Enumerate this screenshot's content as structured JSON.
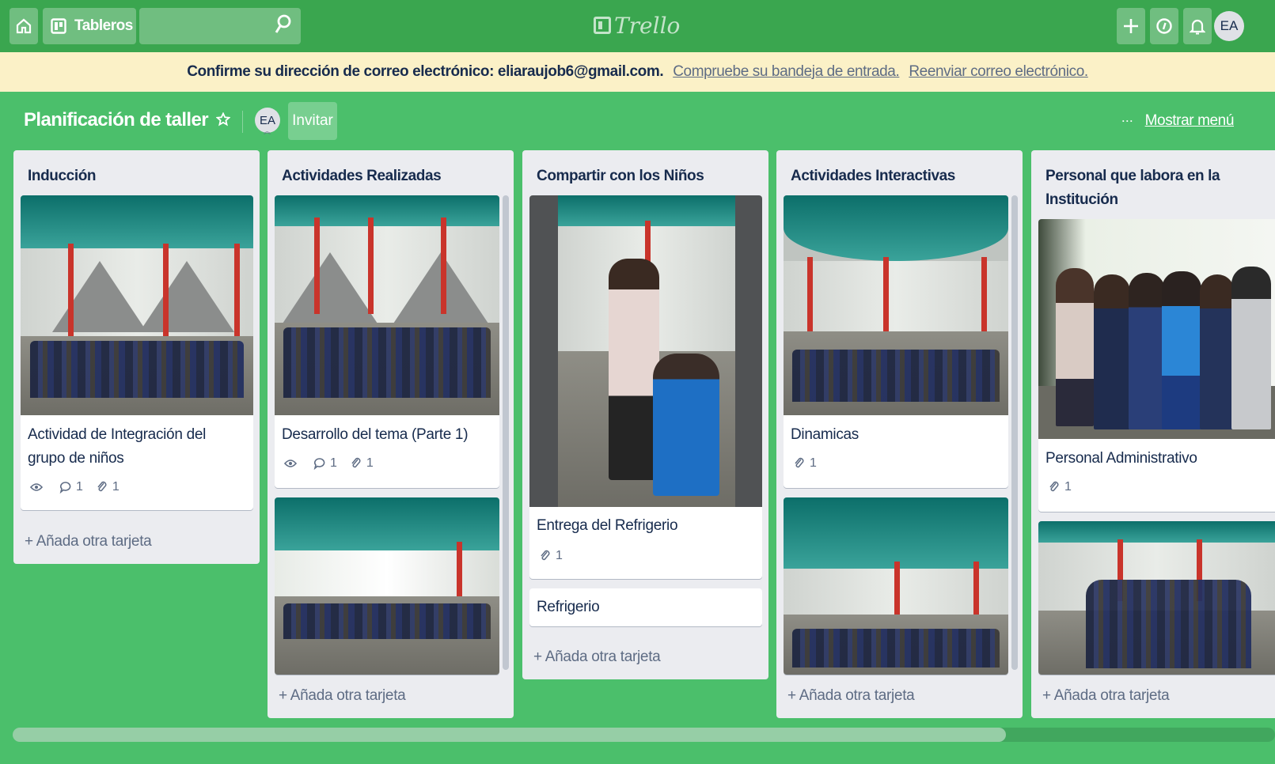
{
  "header": {
    "boards_label": "Tableros",
    "logo_text": "Trello",
    "search_placeholder": "",
    "user_initials": "EA"
  },
  "banner": {
    "message": "Confirme su dirección de correo electrónico: eliaraujob6@gmail.com.",
    "check_link": "Compruebe su bandeja de entrada.",
    "resend_link": "Reenviar correo electrónico."
  },
  "board": {
    "title": "Planificación de taller",
    "member_initials": "EA",
    "invite_label": "Invitar",
    "menu_label": "Mostrar menú",
    "menu_dots": "···"
  },
  "lists": [
    {
      "title": "Inducción",
      "cards": [
        {
          "title": "Actividad de Integración del grupo de niños",
          "comments": "1",
          "attachments": "1"
        }
      ],
      "add_label": "Añada otra tarjeta"
    },
    {
      "title": "Actividades Realizadas",
      "cards": [
        {
          "title": "Desarrollo del tema (Parte 1)",
          "comments": "1",
          "attachments": "1"
        }
      ],
      "add_label": "Añada otra tarjeta"
    },
    {
      "title": "Compartir con los Niños",
      "cards": [
        {
          "title": "Entrega del Refrigerio",
          "attachments": "1"
        },
        {
          "title": "Refrigerio"
        }
      ],
      "add_label": "Añada otra tarjeta"
    },
    {
      "title": "Actividades Interactivas",
      "cards": [
        {
          "title": "Dinamicas",
          "attachments": "1"
        }
      ],
      "add_label": "Añada otra tarjeta"
    },
    {
      "title": "Personal que labora en la Institución",
      "cards": [
        {
          "title": "Personal Administrativo",
          "attachments": "1"
        }
      ],
      "add_label": "Añada otra tarjeta"
    }
  ],
  "colors": {
    "board_bg": "#4bbf6b",
    "header_bg": "#3aa64f",
    "banner_bg": "#fbf1c7",
    "list_bg": "#ebecf0"
  }
}
